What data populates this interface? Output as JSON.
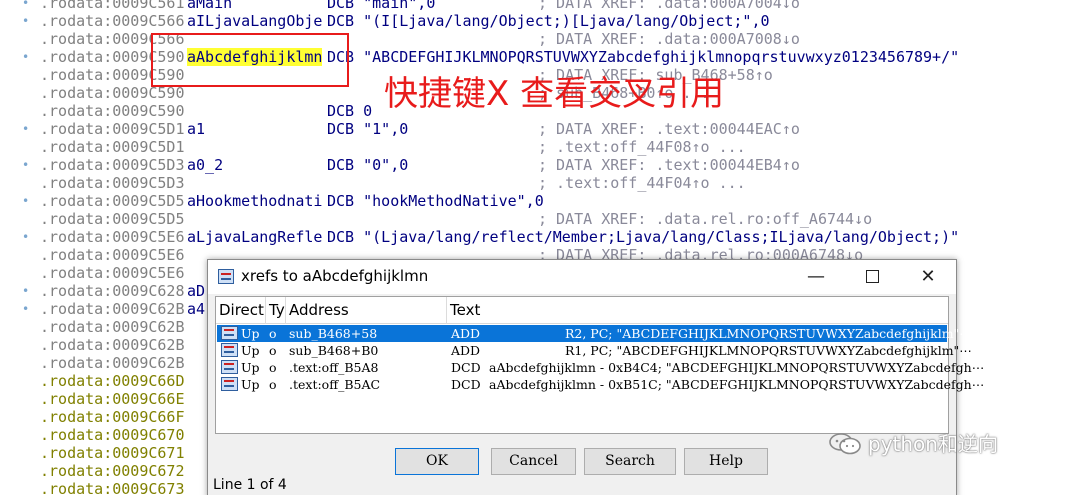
{
  "listing": [
    {
      "addr": ".rodata:0009C561",
      "ext": false,
      "label": "aMain",
      "instr": "DCB \"main\",0",
      "comment": "; DATA XREF: .data:000A7004↓o"
    },
    {
      "addr": ".rodata:0009C566",
      "ext": false,
      "label": "aILjavaLangObje",
      "instr": "DCB \"(I[Ljava/lang/Object;)[Ljava/lang/Object;\",0",
      "comment": ""
    },
    {
      "addr": ".rodata:0009C566",
      "ext": false,
      "label": "",
      "instr": "",
      "comment": "; DATA XREF: .data:000A7008↓o"
    },
    {
      "addr": ".rodata:0009C590",
      "ext": false,
      "label": "aAbcdefghijklmn",
      "highlight": true,
      "instr": "DCB \"ABCDEFGHIJKLMNOPQRSTUVWXYZabcdefghijklmnopqrstuvwxyz0123456789+/\"",
      "comment": ""
    },
    {
      "addr": ".rodata:0009C590",
      "ext": false,
      "label": "",
      "instr": "",
      "comment": "; DATA XREF: sub_B468+58↑o"
    },
    {
      "addr": ".rodata:0009C590",
      "ext": false,
      "label": "",
      "instr": "",
      "comment": "; sub_B468+B0↑o ..."
    },
    {
      "addr": ".rodata:0009C590",
      "ext": false,
      "label": "",
      "instr": "DCB 0",
      "comment": ""
    },
    {
      "addr": ".rodata:0009C5D1",
      "ext": false,
      "label": "a1",
      "instr": "DCB \"1\",0",
      "comment": "; DATA XREF: .text:00044EAC↑o"
    },
    {
      "addr": ".rodata:0009C5D1",
      "ext": false,
      "label": "",
      "instr": "",
      "comment": "; .text:off_44F08↑o ..."
    },
    {
      "addr": ".rodata:0009C5D3",
      "ext": false,
      "label": "a0_2",
      "instr": "DCB \"0\",0",
      "comment": "; DATA XREF: .text:00044EB4↑o"
    },
    {
      "addr": ".rodata:0009C5D3",
      "ext": false,
      "label": "",
      "instr": "",
      "comment": "; .text:off_44F04↑o ..."
    },
    {
      "addr": ".rodata:0009C5D5",
      "ext": false,
      "label": "aHookmethodnati",
      "instr": "DCB \"hookMethodNative\",0",
      "comment": ""
    },
    {
      "addr": ".rodata:0009C5D5",
      "ext": false,
      "label": "",
      "instr": "",
      "comment": "; DATA XREF: .data.rel.ro:off_A6744↓o"
    },
    {
      "addr": ".rodata:0009C5E6",
      "ext": false,
      "label": "aLjavaLangRefle",
      "instr": "DCB \"(Ljava/lang/reflect/Member;Ljava/lang/Class;ILjava/lang/Object;)\"",
      "comment": ""
    },
    {
      "addr": ".rodata:0009C5E6",
      "ext": false,
      "label": "",
      "instr": "",
      "comment": "; DATA XREF: .data.rel.ro:000A6748↓o"
    },
    {
      "addr": ".rodata:0009C5E6",
      "ext": false,
      "label": "",
      "instr": "",
      "comment": ""
    },
    {
      "addr": ".rodata:0009C628",
      "ext": false,
      "label": "aD",
      "instr": "",
      "comment": ""
    },
    {
      "addr": ".rodata:0009C62B",
      "ext": false,
      "label": "a4",
      "instr": "",
      "comment": ""
    },
    {
      "addr": ".rodata:0009C62B",
      "ext": false,
      "label": "",
      "instr": "",
      "comment": ""
    },
    {
      "addr": ".rodata:0009C62B",
      "ext": false,
      "label": "",
      "instr": "",
      "comment": ""
    },
    {
      "addr": ".rodata:0009C62B",
      "ext": false,
      "label": "",
      "instr": "",
      "comment": ""
    },
    {
      "addr": ".rodata:0009C66D",
      "ext": true,
      "label": "",
      "instr": "",
      "comment": ""
    },
    {
      "addr": ".rodata:0009C66E",
      "ext": true,
      "label": "",
      "instr": "",
      "comment": ""
    },
    {
      "addr": ".rodata:0009C66F",
      "ext": true,
      "label": "",
      "instr": "",
      "comment": ""
    },
    {
      "addr": ".rodata:0009C670",
      "ext": true,
      "label": "",
      "instr": "",
      "comment": ""
    },
    {
      "addr": ".rodata:0009C671",
      "ext": true,
      "label": "",
      "instr": "",
      "comment": ""
    },
    {
      "addr": ".rodata:0009C672",
      "ext": true,
      "label": "",
      "instr": "",
      "comment": ""
    },
    {
      "addr": ".rodata:0009C673",
      "ext": true,
      "label": "",
      "instr": "",
      "comment": ""
    }
  ],
  "annotation": {
    "text": "快捷键X 查看交叉引用",
    "color": "#e81b1b"
  },
  "dialog": {
    "title": "xrefs to aAbcdefghijklmn",
    "minimize_glyph": "—",
    "close_glyph": "✕",
    "columns": {
      "direction": "Direct",
      "type": "Ty",
      "address": "Address",
      "text": "Text"
    },
    "rows": [
      {
        "direction": "Up",
        "type": "o",
        "address": "sub_B468+58",
        "op": "ADD",
        "mid": "",
        "rest": "R2, PC; \"ABCDEFGHIJKLMNOPQRSTUVWXYZabcdefghijklm\"⋯",
        "selected": true
      },
      {
        "direction": "Up",
        "type": "o",
        "address": "sub_B468+B0",
        "op": "ADD",
        "mid": "",
        "rest": "R1, PC; \"ABCDEFGHIJKLMNOPQRSTUVWXYZabcdefghijklm\"⋯",
        "selected": false
      },
      {
        "direction": "Up",
        "type": "o",
        "address": ".text:off_B5A8",
        "op": "DCD",
        "mid": "aAbcdefghijklmn - 0xB4C4; \"ABCDEFGHIJKLMNOPQRSTUVWXYZabcdefgh⋯",
        "rest": "",
        "selected": false
      },
      {
        "direction": "Up",
        "type": "o",
        "address": ".text:off_B5AC",
        "op": "DCD",
        "mid": "aAbcdefghijklmn - 0xB51C; \"ABCDEFGHIJKLMNOPQRSTUVWXYZabcdefgh⋯",
        "rest": "",
        "selected": false
      }
    ],
    "buttons": {
      "ok": "OK",
      "cancel": "Cancel",
      "search": "Search",
      "help": "Help"
    },
    "status": "Line 1 of 4"
  },
  "watermark": {
    "text": "python和逆向",
    "icon": "wechat-icon"
  }
}
